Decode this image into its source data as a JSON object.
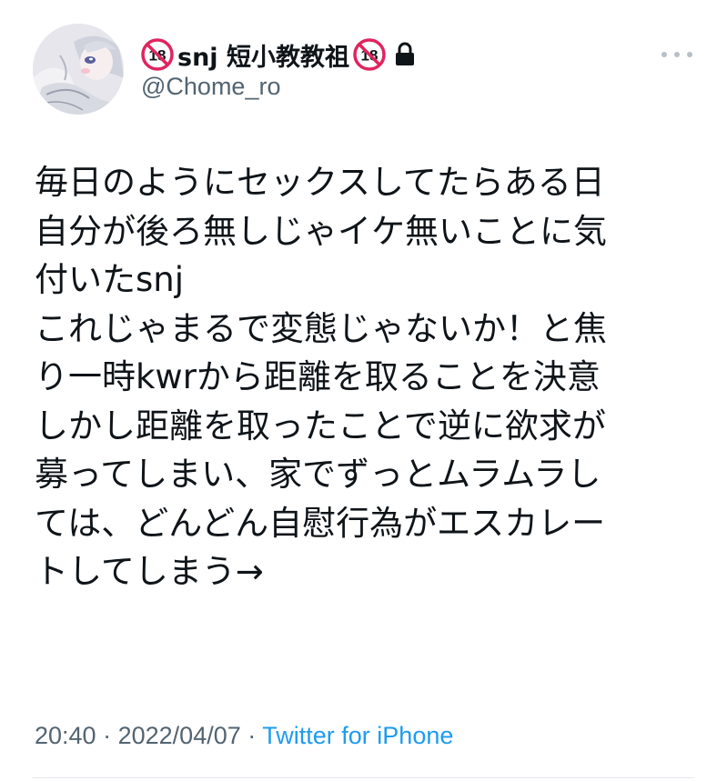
{
  "tweet": {
    "author": {
      "display_name": "snj 短小教教祖",
      "prefix_badge": "no-under-18-icon",
      "suffix_badge": "no-under-18-icon",
      "badge_text": "18",
      "protected_icon": "lock-icon",
      "handle": "@Chome_ro",
      "avatar": "avatar-illustration"
    },
    "more_icon": "more-dots-icon",
    "body_lines": [
      "毎日のようにセックスしてたらある日",
      "自分が後ろ無しじゃイケ無いことに気",
      "付いたsnj",
      "これじゃまるで変態じゃないか！と焦",
      "り一時kwrから距離を取ることを決意",
      "しかし距離を取ったことで逆に欲求が",
      "募ってしまい、家でずっとムラムラし",
      "ては、どんどん自慰行為がエスカレー",
      "トしてしまう→"
    ],
    "time": "20:40",
    "separator": "·",
    "date": "2022/04/07",
    "source": "Twitter for iPhone"
  },
  "colors": {
    "text_primary": "#0f1419",
    "text_secondary": "#536471",
    "link": "#1d9bf0",
    "badge_red": "#e0245e"
  }
}
